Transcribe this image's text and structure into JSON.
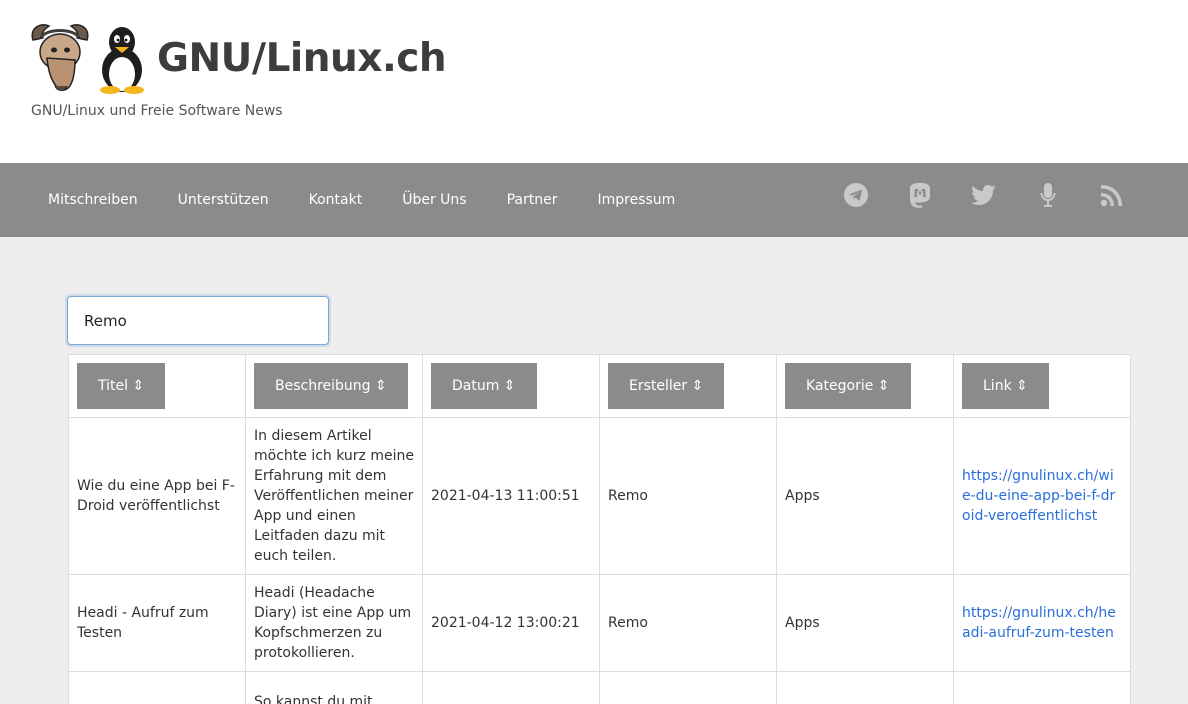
{
  "site": {
    "title": "GNU/Linux.ch",
    "tagline": "GNU/Linux und Freie Software News"
  },
  "nav": {
    "links": [
      "Mitschreiben",
      "Unterstützen",
      "Kontakt",
      "Über Uns",
      "Partner",
      "Impressum"
    ],
    "social_icons": [
      "telegram-icon",
      "mastodon-icon",
      "twitter-icon",
      "microphone-icon",
      "rss-icon"
    ]
  },
  "colors": {
    "navbar": "#8b8b8b",
    "background": "#eeeeee",
    "link": "#2a6fdb",
    "social_icon": "#c9c9c9"
  },
  "search": {
    "value": "Remo"
  },
  "table": {
    "headers": [
      "Titel ⇕",
      "Beschreibung ⇕",
      "Datum ⇕",
      "Ersteller ⇕",
      "Kategorie ⇕",
      "Link ⇕"
    ],
    "rows": [
      {
        "title": "Wie du eine App bei F-Droid veröffentlichst",
        "description": "In diesem Artikel möchte ich kurz meine Erfahrung mit dem Veröffentlichen meiner App und einen Leitfaden dazu mit euch teilen.",
        "date": "2021-04-13 11:00:51",
        "author": "Remo",
        "category": "Apps",
        "link": "https://gnulinux.ch/wie-du-eine-app-bei-f-droid-veroeffentlichst"
      },
      {
        "title": "Headi - Aufruf zum Testen",
        "description": "Headi (Headache Diary) ist eine App um Kopfschmerzen zu protokollieren.",
        "date": "2021-04-12 13:00:21",
        "author": "Remo",
        "category": "Apps",
        "link": "https://gnulinux.ch/headi-aufruf-zum-testen"
      },
      {
        "title": "",
        "description": "So kannst du mit",
        "date": "",
        "author": "",
        "category": "",
        "link": ""
      }
    ]
  }
}
